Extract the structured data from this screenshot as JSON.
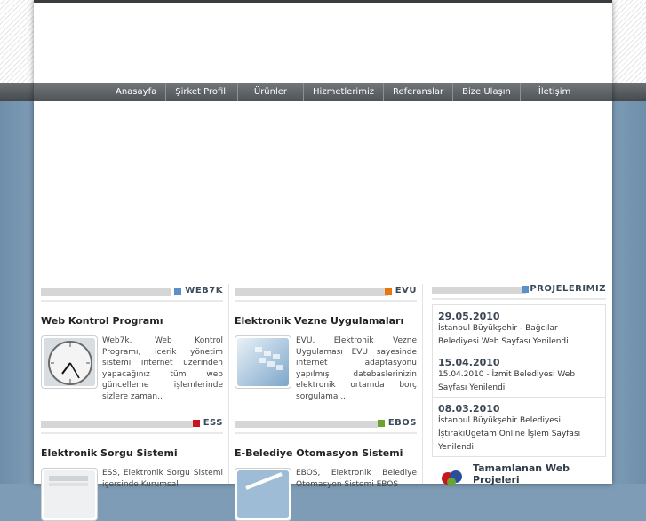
{
  "nav": {
    "items": [
      "Anasayfa",
      "Şirket Profili",
      "Ürünler",
      "Hizmetlerimiz",
      "Referanslar",
      "Bize Ulaşın",
      "İletişim"
    ]
  },
  "sections": {
    "web7k": {
      "code": "WEB7K",
      "color": "#5b8fc7",
      "title": "Web Kontrol Programı",
      "desc": "Web7k, Web Kontrol Programı, icerik yönetim sistemi internet üzerinden yapacağınız tüm web güncelleme işlemlerinde sizlere zaman.."
    },
    "evu": {
      "code": "EVU",
      "color": "#e8770f",
      "title": "Elektronik Vezne Uygulamaları",
      "desc": "EVU, Elektronik Vezne Uygulaması EVU sayesinde internet adaptasyonu yapılmış datebaslerinizin elektronik ortamda borç sorgulama .."
    },
    "ess": {
      "code": "ESS",
      "color": "#c8161d",
      "title": "Elektronik Sorgu Sistemi",
      "desc": "ESS, Elektronik Sorgu Sistemi içersinde Kurumsal"
    },
    "ebos": {
      "code": "EBOS",
      "color": "#6aa332",
      "title": "E-Belediye Otomasyon Sistemi",
      "desc": "EBOS, Elektronik Belediye Otomasyon Sistemi EBOS"
    }
  },
  "projects": {
    "heading": "PROJELERIMIZ",
    "color": "#5b8fc7",
    "news": [
      {
        "date": "29.05.2010",
        "text": "İstanbul Büyükşehir - Bağcılar Belediyesi Web Sayfası Yenilendi"
      },
      {
        "date": "15.04.2010",
        "text": "15.04.2010 - İzmit Belediyesi Web Sayfası Yenilendi"
      },
      {
        "date": "08.03.2010",
        "text": "İstanbul Büyükşehir Belediyesi İştirakiUgetam Online İşlem Sayfası Yenilendi"
      }
    ],
    "completed": "Tamamlanan Web Projeleri"
  },
  "icons": [
    "clock-icon",
    "keyboard-icon",
    "papers-icon",
    "pen-icon",
    "globe-logo-icon"
  ]
}
